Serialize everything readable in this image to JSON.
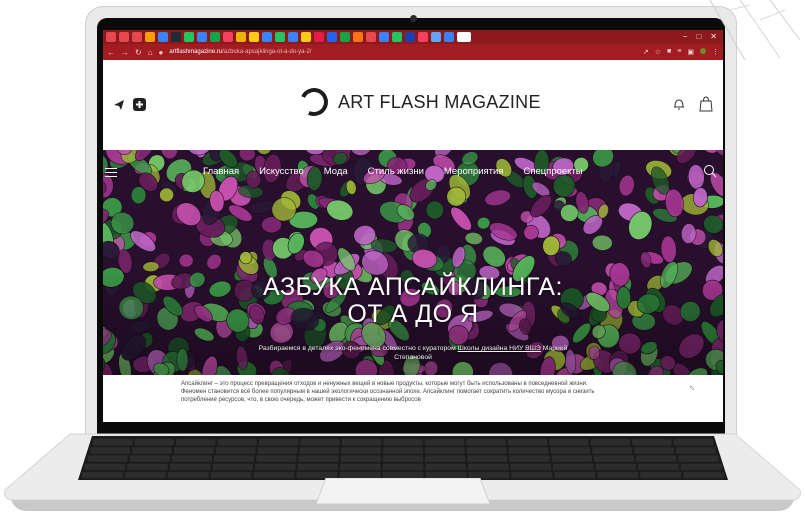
{
  "browser": {
    "url_domain": "artflashmagazine.ru",
    "url_path": "/azbuka-apsajklinga-ot-a-do-ya-2/",
    "accent": "#a21d22"
  },
  "site": {
    "logo_text": "ART FLASH MAGAZINE",
    "nav": [
      "Главная",
      "Искусство",
      "Мода",
      "Стиль жизни",
      "Мероприятия",
      "Спецпроекты"
    ]
  },
  "hero": {
    "title_line1": "АЗБУКА АПСАЙКЛИНГА:",
    "title_line2": "ОТ А ДО Я",
    "subtitle_pre": "Разбираемся в деталях эко-феномена совместно с куратором ",
    "subtitle_link": "Школы дизайна НИУ ВШЭ",
    "subtitle_post": " Марией Степановой"
  },
  "article": {
    "text": "Апсайклинг – это процесс превращения отходов и ненужных вещей в новые продукты, которые могут быть использованы в повседневной жизни. Феномен становится всё более популярным в нашей экологически осознанной эпохе. Апсайклинг помогает сократить количество мусора и снизить потребление ресурсов, что, в свою очередь, может привести к сокращению выбросов"
  },
  "icons": {
    "social": [
      "telegram-icon",
      "plus-box-icon"
    ],
    "header_right": [
      "bell-icon",
      "shopping-bag-icon"
    ],
    "hero": [
      "menu-icon",
      "search-icon"
    ]
  }
}
